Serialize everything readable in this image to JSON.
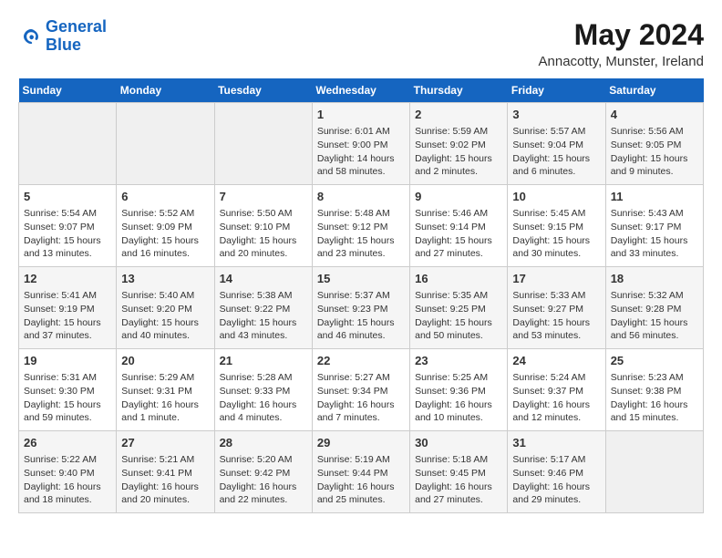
{
  "logo": {
    "line1": "General",
    "line2": "Blue"
  },
  "title": "May 2024",
  "subtitle": "Annacotty, Munster, Ireland",
  "days_of_week": [
    "Sunday",
    "Monday",
    "Tuesday",
    "Wednesday",
    "Thursday",
    "Friday",
    "Saturday"
  ],
  "weeks": [
    [
      {
        "day": "",
        "info": ""
      },
      {
        "day": "",
        "info": ""
      },
      {
        "day": "",
        "info": ""
      },
      {
        "day": "1",
        "info": "Sunrise: 6:01 AM\nSunset: 9:00 PM\nDaylight: 14 hours\nand 58 minutes."
      },
      {
        "day": "2",
        "info": "Sunrise: 5:59 AM\nSunset: 9:02 PM\nDaylight: 15 hours\nand 2 minutes."
      },
      {
        "day": "3",
        "info": "Sunrise: 5:57 AM\nSunset: 9:04 PM\nDaylight: 15 hours\nand 6 minutes."
      },
      {
        "day": "4",
        "info": "Sunrise: 5:56 AM\nSunset: 9:05 PM\nDaylight: 15 hours\nand 9 minutes."
      }
    ],
    [
      {
        "day": "5",
        "info": "Sunrise: 5:54 AM\nSunset: 9:07 PM\nDaylight: 15 hours\nand 13 minutes."
      },
      {
        "day": "6",
        "info": "Sunrise: 5:52 AM\nSunset: 9:09 PM\nDaylight: 15 hours\nand 16 minutes."
      },
      {
        "day": "7",
        "info": "Sunrise: 5:50 AM\nSunset: 9:10 PM\nDaylight: 15 hours\nand 20 minutes."
      },
      {
        "day": "8",
        "info": "Sunrise: 5:48 AM\nSunset: 9:12 PM\nDaylight: 15 hours\nand 23 minutes."
      },
      {
        "day": "9",
        "info": "Sunrise: 5:46 AM\nSunset: 9:14 PM\nDaylight: 15 hours\nand 27 minutes."
      },
      {
        "day": "10",
        "info": "Sunrise: 5:45 AM\nSunset: 9:15 PM\nDaylight: 15 hours\nand 30 minutes."
      },
      {
        "day": "11",
        "info": "Sunrise: 5:43 AM\nSunset: 9:17 PM\nDaylight: 15 hours\nand 33 minutes."
      }
    ],
    [
      {
        "day": "12",
        "info": "Sunrise: 5:41 AM\nSunset: 9:19 PM\nDaylight: 15 hours\nand 37 minutes."
      },
      {
        "day": "13",
        "info": "Sunrise: 5:40 AM\nSunset: 9:20 PM\nDaylight: 15 hours\nand 40 minutes."
      },
      {
        "day": "14",
        "info": "Sunrise: 5:38 AM\nSunset: 9:22 PM\nDaylight: 15 hours\nand 43 minutes."
      },
      {
        "day": "15",
        "info": "Sunrise: 5:37 AM\nSunset: 9:23 PM\nDaylight: 15 hours\nand 46 minutes."
      },
      {
        "day": "16",
        "info": "Sunrise: 5:35 AM\nSunset: 9:25 PM\nDaylight: 15 hours\nand 50 minutes."
      },
      {
        "day": "17",
        "info": "Sunrise: 5:33 AM\nSunset: 9:27 PM\nDaylight: 15 hours\nand 53 minutes."
      },
      {
        "day": "18",
        "info": "Sunrise: 5:32 AM\nSunset: 9:28 PM\nDaylight: 15 hours\nand 56 minutes."
      }
    ],
    [
      {
        "day": "19",
        "info": "Sunrise: 5:31 AM\nSunset: 9:30 PM\nDaylight: 15 hours\nand 59 minutes."
      },
      {
        "day": "20",
        "info": "Sunrise: 5:29 AM\nSunset: 9:31 PM\nDaylight: 16 hours\nand 1 minute."
      },
      {
        "day": "21",
        "info": "Sunrise: 5:28 AM\nSunset: 9:33 PM\nDaylight: 16 hours\nand 4 minutes."
      },
      {
        "day": "22",
        "info": "Sunrise: 5:27 AM\nSunset: 9:34 PM\nDaylight: 16 hours\nand 7 minutes."
      },
      {
        "day": "23",
        "info": "Sunrise: 5:25 AM\nSunset: 9:36 PM\nDaylight: 16 hours\nand 10 minutes."
      },
      {
        "day": "24",
        "info": "Sunrise: 5:24 AM\nSunset: 9:37 PM\nDaylight: 16 hours\nand 12 minutes."
      },
      {
        "day": "25",
        "info": "Sunrise: 5:23 AM\nSunset: 9:38 PM\nDaylight: 16 hours\nand 15 minutes."
      }
    ],
    [
      {
        "day": "26",
        "info": "Sunrise: 5:22 AM\nSunset: 9:40 PM\nDaylight: 16 hours\nand 18 minutes."
      },
      {
        "day": "27",
        "info": "Sunrise: 5:21 AM\nSunset: 9:41 PM\nDaylight: 16 hours\nand 20 minutes."
      },
      {
        "day": "28",
        "info": "Sunrise: 5:20 AM\nSunset: 9:42 PM\nDaylight: 16 hours\nand 22 minutes."
      },
      {
        "day": "29",
        "info": "Sunrise: 5:19 AM\nSunset: 9:44 PM\nDaylight: 16 hours\nand 25 minutes."
      },
      {
        "day": "30",
        "info": "Sunrise: 5:18 AM\nSunset: 9:45 PM\nDaylight: 16 hours\nand 27 minutes."
      },
      {
        "day": "31",
        "info": "Sunrise: 5:17 AM\nSunset: 9:46 PM\nDaylight: 16 hours\nand 29 minutes."
      },
      {
        "day": "",
        "info": ""
      }
    ]
  ]
}
